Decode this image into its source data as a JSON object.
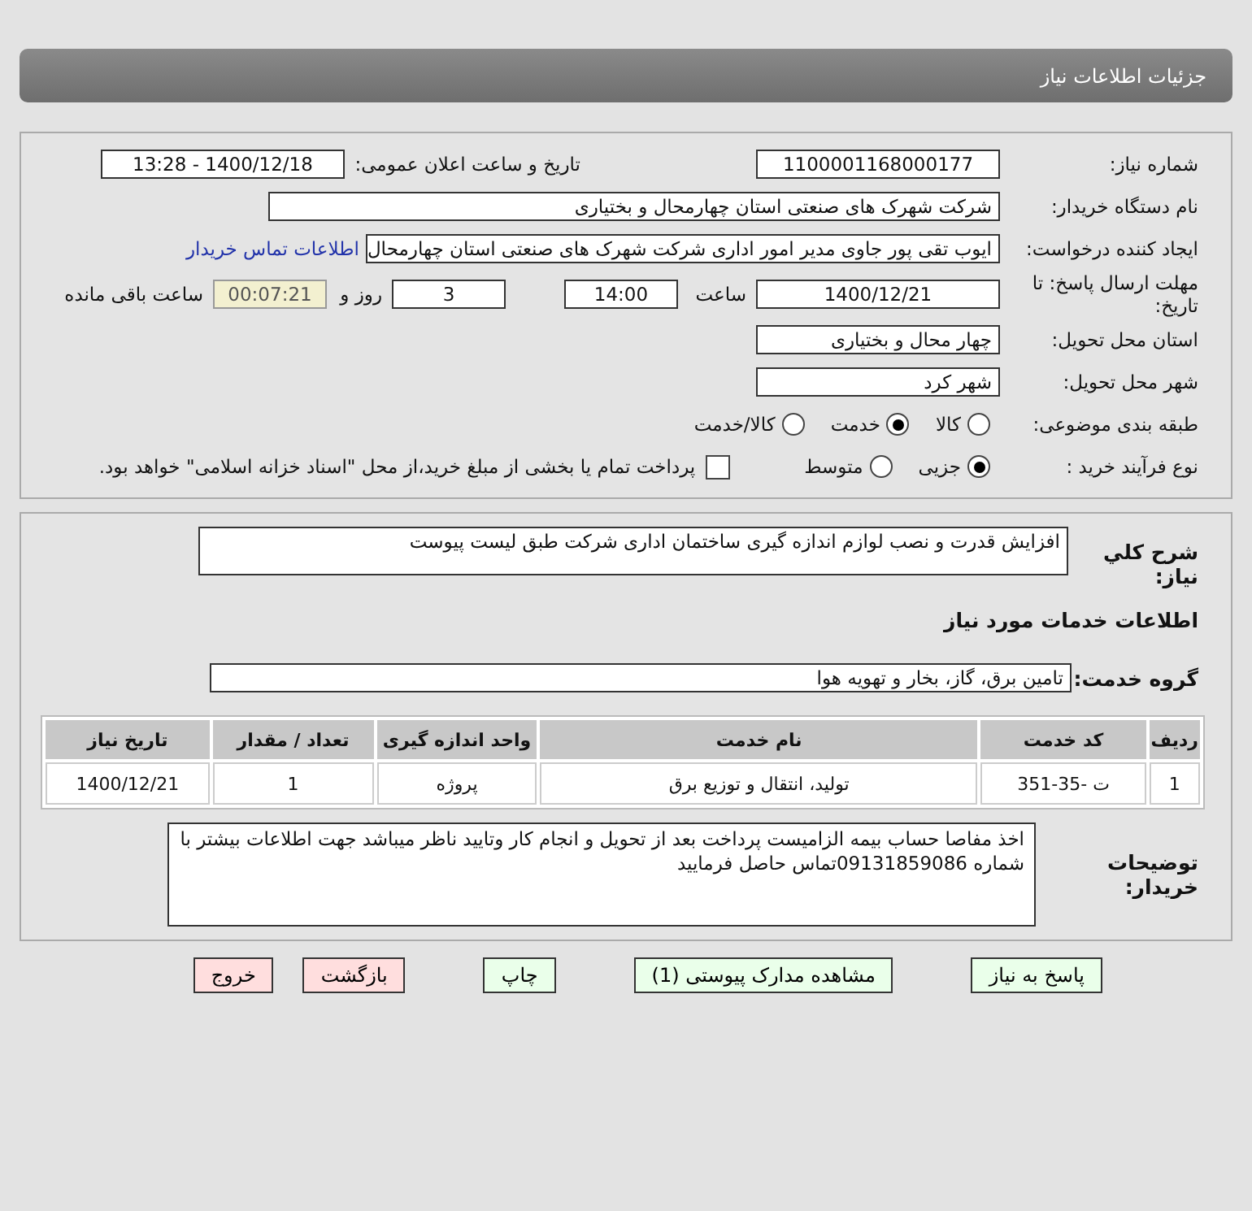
{
  "title": "جزئیات اطلاعات نیاز",
  "need_number": {
    "label": "شماره نیاز:",
    "value": "1100001168000177"
  },
  "announce": {
    "label": "تاریخ و ساعت اعلان عمومی:",
    "value": "1400/12/18 - 13:28"
  },
  "buyer": {
    "label": "نام دستگاه خریدار:",
    "value": "شرکت شهرک های صنعتی استان چهارمحال و بختیاری"
  },
  "requester": {
    "label": "ایجاد کننده درخواست:",
    "value": "ایوب تقی پور جاوی مدیر امور اداری شرکت شهرک های صنعتی استان چهارمحال",
    "link": "اطلاعات تماس خریدار"
  },
  "deadline": {
    "label": "مهلت ارسال پاسخ: تا تاریخ:",
    "date": "1400/12/21",
    "time_label": "ساعت",
    "time": "14:00",
    "days": "3",
    "days_label": "روز و",
    "remaining": "00:07:21",
    "remaining_label": "ساعت باقی مانده"
  },
  "province": {
    "label": "استان محل تحویل:",
    "value": "چهار محال و بختیاری"
  },
  "city": {
    "label": "شهر محل تحویل:",
    "value": "شهر کرد"
  },
  "category": {
    "label": "طبقه بندی موضوعی:",
    "options": [
      {
        "label": "کالا",
        "selected": false
      },
      {
        "label": "خدمت",
        "selected": true
      },
      {
        "label": "کالا/خدمت",
        "selected": false
      }
    ]
  },
  "process": {
    "label": "نوع فرآیند خرید :",
    "options": [
      {
        "label": "جزیی",
        "selected": true
      },
      {
        "label": "متوسط",
        "selected": false
      }
    ],
    "payment": {
      "label": "پرداخت تمام یا بخشی از مبلغ خرید،از محل \"اسناد خزانه اسلامی\" خواهد بود.",
      "checked": false
    }
  },
  "description": {
    "label": "شرح کلي نياز:",
    "value": "افزایش قدرت و نصب لوازم اندازه گیری ساختمان  اداری شرکت طبق لیست پیوست"
  },
  "services_title": "اطلاعات خدمات مورد نیاز",
  "service_group": {
    "label": "گروه خدمت:",
    "value": "تامین برق، گاز، بخار و تهویه هوا"
  },
  "table": {
    "columns": [
      "ردیف",
      "کد خدمت",
      "نام خدمت",
      "واحد اندازه گیری",
      "تعداد / مقدار",
      "تاریخ نیاز"
    ],
    "rows": [
      [
        "1",
        "ت -35-351",
        "تولید، انتقال و توزیع برق",
        "پروژه",
        "1",
        "1400/12/21"
      ]
    ]
  },
  "buyer_notes": {
    "label": "توضیحات خریدار:",
    "value": "اخذ مفاصا حساب بیمه الزامیست پرداخت بعد از تحویل و انجام کار وتایید ناظر میباشد جهت اطلاعات بیشتر با شماره 09131859086تماس حاصل فرمایید"
  },
  "buttons": [
    {
      "label": "پاسخ به نیاز",
      "kind": "action"
    },
    {
      "label": "مشاهده مدارک پیوستی (1)",
      "kind": "action"
    },
    {
      "label": "چاپ",
      "kind": "action"
    },
    {
      "label": "بازگشت",
      "kind": "exit"
    },
    {
      "label": "خروج",
      "kind": "exit"
    }
  ]
}
